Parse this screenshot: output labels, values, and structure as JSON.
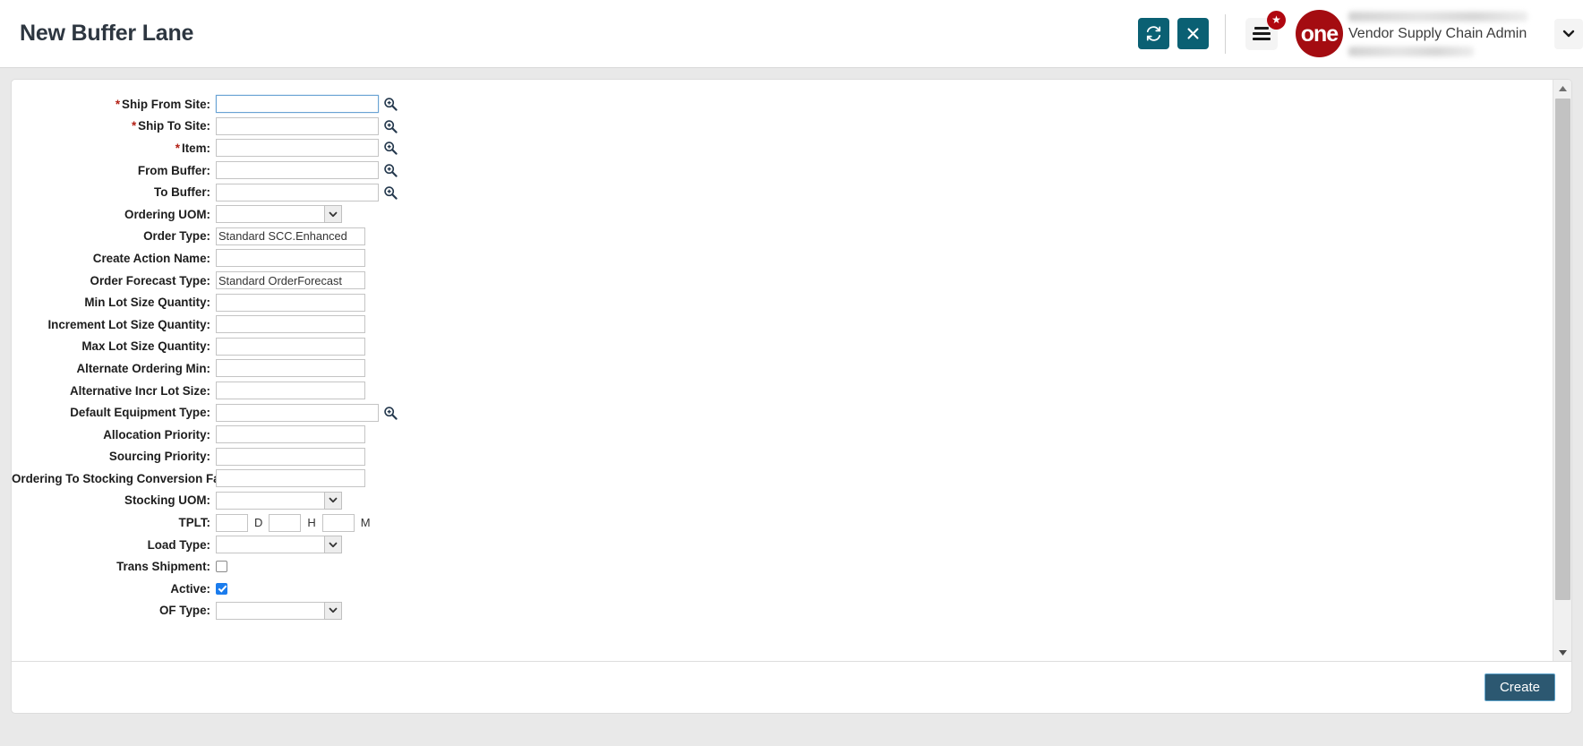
{
  "header": {
    "title": "New Buffer Lane",
    "refresh_icon": "refresh-icon",
    "close_icon": "close-icon",
    "menu_icon": "hamburger-menu-icon",
    "badge_icon": "star-badge-icon",
    "badge_glyph": "★",
    "brand_logo_text": "one",
    "user_role": "Vendor Supply Chain Admin",
    "caret_icon": "chevron-down-icon",
    "teal_color": "#0a6073",
    "brand_color": "#a40c11"
  },
  "form": {
    "rows": [
      {
        "label": "Ship From Site:",
        "required": true,
        "type": "text-lookup",
        "value": "",
        "focused": true
      },
      {
        "label": "Ship To Site:",
        "required": true,
        "type": "text-lookup",
        "value": ""
      },
      {
        "label": "Item:",
        "required": true,
        "type": "text-lookup",
        "value": ""
      },
      {
        "label": "From Buffer:",
        "required": false,
        "type": "text-lookup",
        "value": ""
      },
      {
        "label": "To Buffer:",
        "required": false,
        "type": "text-lookup",
        "value": ""
      },
      {
        "label": "Ordering UOM:",
        "required": false,
        "type": "select",
        "value": ""
      },
      {
        "label": "Order Type:",
        "required": false,
        "type": "text",
        "value": "Standard SCC.Enhanced"
      },
      {
        "label": "Create Action Name:",
        "required": false,
        "type": "text",
        "value": ""
      },
      {
        "label": "Order Forecast Type:",
        "required": false,
        "type": "text",
        "value": "Standard OrderForecast"
      },
      {
        "label": "Min Lot Size Quantity:",
        "required": false,
        "type": "text",
        "value": ""
      },
      {
        "label": "Increment Lot Size Quantity:",
        "required": false,
        "type": "text",
        "value": ""
      },
      {
        "label": "Max Lot Size Quantity:",
        "required": false,
        "type": "text",
        "value": ""
      },
      {
        "label": "Alternate Ordering Min:",
        "required": false,
        "type": "text",
        "value": ""
      },
      {
        "label": "Alternative Incr Lot Size:",
        "required": false,
        "type": "text",
        "value": ""
      },
      {
        "label": "Default Equipment Type:",
        "required": false,
        "type": "text-lookup",
        "value": ""
      },
      {
        "label": "Allocation Priority:",
        "required": false,
        "type": "text",
        "value": ""
      },
      {
        "label": "Sourcing Priority:",
        "required": false,
        "type": "text",
        "value": ""
      },
      {
        "label": "Ordering To Stocking Conversion Factor:",
        "required": false,
        "type": "text",
        "value": ""
      },
      {
        "label": "Stocking UOM:",
        "required": false,
        "type": "select",
        "value": ""
      },
      {
        "label": "TPLT:",
        "required": false,
        "type": "duration",
        "days": "",
        "hours": "",
        "minutes": "",
        "unit_d": "D",
        "unit_h": "H",
        "unit_m": "M"
      },
      {
        "label": "Load Type:",
        "required": false,
        "type": "select",
        "value": ""
      },
      {
        "label": "Trans Shipment:",
        "required": false,
        "type": "checkbox",
        "checked": false
      },
      {
        "label": "Active:",
        "required": false,
        "type": "checkbox",
        "checked": true
      },
      {
        "label": "OF Type:",
        "required": false,
        "type": "select",
        "value": ""
      }
    ],
    "lookup_icon": "search-zoom-icon",
    "dropdown_icon": "chevron-down-icon"
  },
  "scrollbar": {
    "up_icon": "scroll-up-arrow-icon",
    "down_icon": "scroll-down-arrow-icon"
  },
  "footer": {
    "create_label": "Create"
  }
}
